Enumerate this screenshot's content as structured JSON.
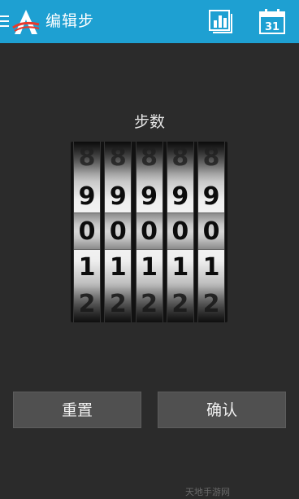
{
  "header": {
    "title": "编辑步",
    "icons": {
      "menu": "drawer-icon",
      "logo": "app-logo",
      "stats": "bar-chart-icon",
      "calendar": "calendar-icon"
    },
    "calendar_day": "31",
    "accent": "#1ea0d2"
  },
  "picker": {
    "label": "步数",
    "wheels": [
      {
        "digits": [
          "8",
          "9",
          "0",
          "1",
          "2"
        ],
        "selected": "0"
      },
      {
        "digits": [
          "8",
          "9",
          "0",
          "1",
          "2"
        ],
        "selected": "0"
      },
      {
        "digits": [
          "8",
          "9",
          "0",
          "1",
          "2"
        ],
        "selected": "0"
      },
      {
        "digits": [
          "8",
          "9",
          "0",
          "1",
          "2"
        ],
        "selected": "0"
      },
      {
        "digits": [
          "8",
          "9",
          "0",
          "1",
          "2"
        ],
        "selected": "0"
      }
    ]
  },
  "actions": {
    "reset_label": "重置",
    "confirm_label": "确认"
  },
  "watermark": "天地手游网"
}
